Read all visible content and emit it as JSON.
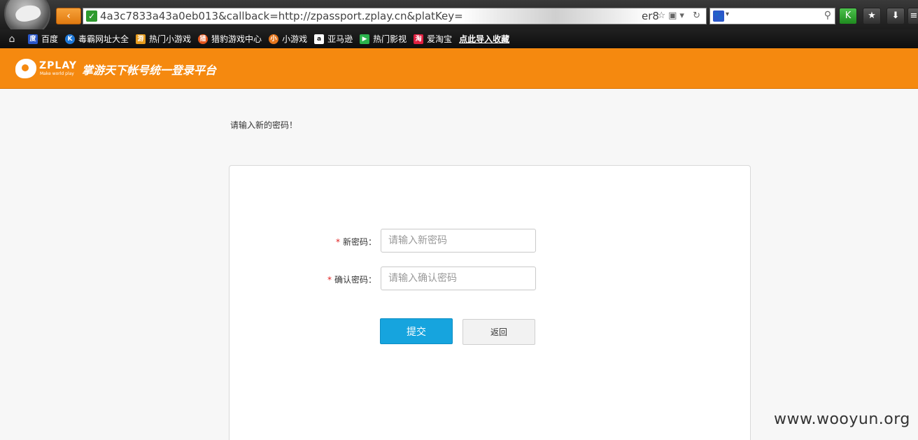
{
  "browser": {
    "back_glyph": "‹",
    "url_prefix": "4a3c7833a43a0eb013&callback=http://zpassport.zplay.cn&platKey=",
    "url_suffix": "er8",
    "url_icons": "☆▣▾ ↻",
    "search_caret": "▾",
    "toolbar_buttons": [
      "K",
      "★",
      "⬇",
      "≡"
    ],
    "icons": [
      "browser-logo",
      "back-icon",
      "secure-check-icon",
      "search-icon"
    ]
  },
  "bookmarks": {
    "items": [
      {
        "label": "百度",
        "icon_text": "度",
        "color": "#2a57c9"
      },
      {
        "label": "毒霸网址大全",
        "icon_text": "K",
        "color": "#1e78d8"
      },
      {
        "label": "热门小游戏",
        "icon_text": "游",
        "color": "#e59b1d"
      },
      {
        "label": "猎豹游戏中心",
        "icon_text": "猎",
        "color": "#e5561d"
      },
      {
        "label": "小游戏",
        "icon_text": "小",
        "color": "#e5761d"
      },
      {
        "label": "亚马逊",
        "icon_text": "a",
        "color": "#ffffff"
      },
      {
        "label": "热门影视",
        "icon_text": "▶",
        "color": "#2bb24c"
      },
      {
        "label": "爱淘宝",
        "icon_text": "淘",
        "color": "#e02040"
      },
      {
        "label": "点此导入收藏",
        "icon_text": "",
        "color": ""
      }
    ]
  },
  "header": {
    "logo_text": "ZPLAY",
    "logo_sub": "Make world play",
    "title": "掌游天下帐号统一登录平台",
    "bg_color": "#f5890f"
  },
  "main": {
    "prompt": "请输入新的密码！",
    "fields": [
      {
        "label": "新密码：",
        "placeholder": "请输入新密码",
        "required_mark": "*"
      },
      {
        "label": "确认密码：",
        "placeholder": "请输入确认密码",
        "required_mark": "*"
      }
    ],
    "submit_label": "提交",
    "back_label": "返回",
    "submit_color": "#16a4de"
  },
  "watermark": "www.wooyun.org"
}
